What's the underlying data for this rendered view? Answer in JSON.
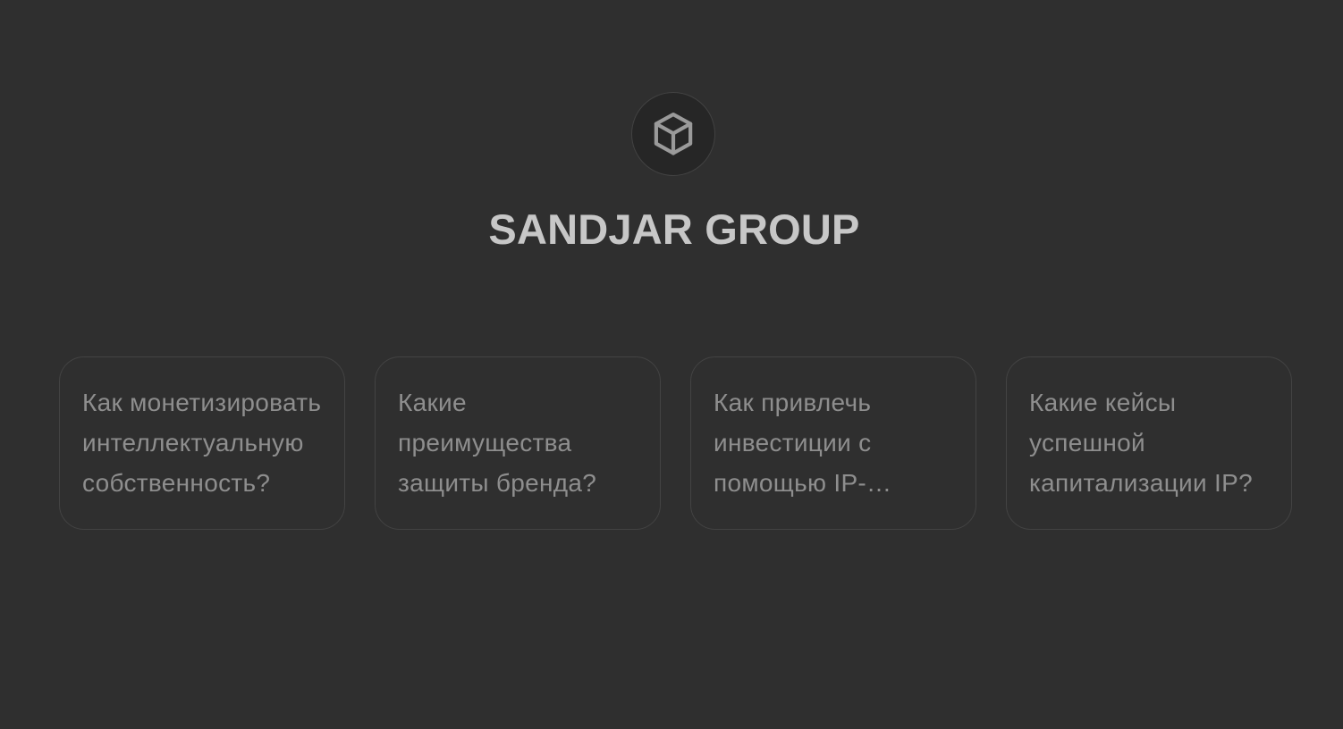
{
  "brand": {
    "name": "SANDJAR GROUP",
    "icon": "cube-icon"
  },
  "suggestions": [
    {
      "text": "Как монетизировать интеллектуальную собственность?"
    },
    {
      "text": "Какие преимущества защиты бренда?"
    },
    {
      "text": "Как привлечь инвестиции с помощью IP-активов?"
    },
    {
      "text": "Какие кейсы успешной капитализации IP?"
    }
  ],
  "colors": {
    "background": "#2f2f2f",
    "card_border": "#434343",
    "title": "#c7c7c7",
    "card_text": "#8e8e8e"
  }
}
